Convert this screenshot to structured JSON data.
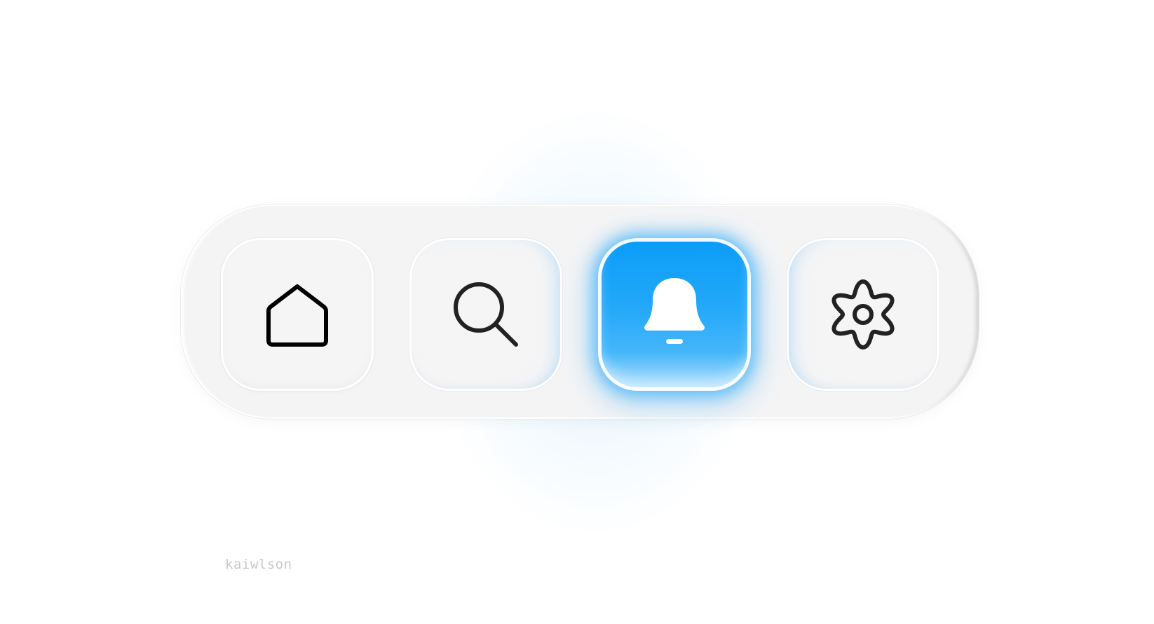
{
  "nav": {
    "items": [
      {
        "id": "home",
        "icon": "home-icon",
        "active": false
      },
      {
        "id": "search",
        "icon": "search-icon",
        "active": false
      },
      {
        "id": "notifications",
        "icon": "bell-icon",
        "active": true
      },
      {
        "id": "settings",
        "icon": "gear-icon",
        "active": false
      }
    ]
  },
  "colors": {
    "accent": "#0a9cf7",
    "accent_light": "#46b6fa",
    "icon_stroke": "#222222",
    "dock_bg": "#f4f4f5",
    "tile_bg": "#f5f5f6"
  },
  "watermark": {
    "text": "kaiwlson"
  }
}
